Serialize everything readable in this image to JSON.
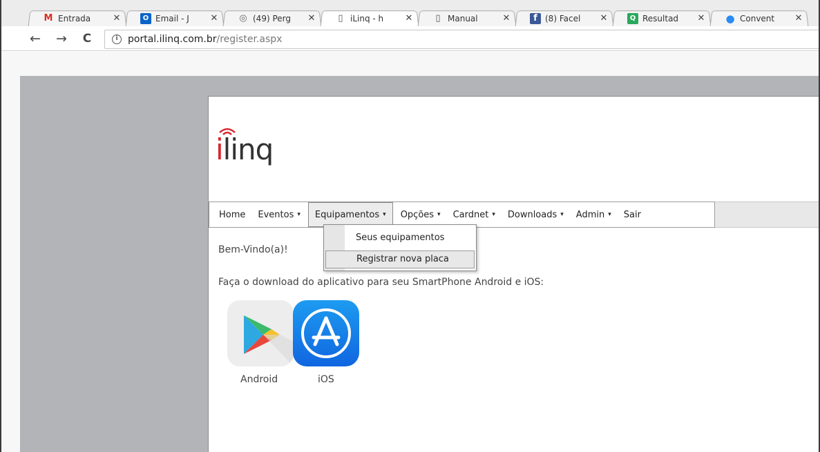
{
  "browser": {
    "tabs": [
      {
        "favicon": "gmail-icon",
        "glyph": "M",
        "color": "#d93025",
        "title": "Entrada"
      },
      {
        "favicon": "outlook-icon",
        "glyph": "O",
        "color": "#0a64c8",
        "title": "Email - J"
      },
      {
        "favicon": "quora-like-icon",
        "glyph": "◎",
        "color": "#666666",
        "title": "(49) Perg"
      },
      {
        "favicon": "page-icon",
        "glyph": "▯",
        "color": "#555555",
        "title": "iLinq - h",
        "active": true
      },
      {
        "favicon": "page-icon",
        "glyph": "▯",
        "color": "#555555",
        "title": "Manual"
      },
      {
        "favicon": "facebook-icon",
        "glyph": "f",
        "color": "#3b5998",
        "title": "(8) Facel"
      },
      {
        "favicon": "qd-icon",
        "glyph": "Q",
        "color": "#2aa85c",
        "title": "Resultad"
      },
      {
        "favicon": "chat-icon",
        "glyph": "●",
        "color": "#2a8cf0",
        "title": "Convent"
      }
    ],
    "close_glyph": "✕",
    "url_host": "portal.ilinq.com.br",
    "url_path": "/register.aspx",
    "back_glyph": "←",
    "forward_glyph": "→",
    "reload_glyph": "C",
    "info_glyph": "i"
  },
  "site": {
    "logo": {
      "i": "i",
      "rest": "linq",
      "accent": "#d7262e"
    },
    "menu": [
      {
        "label": "Home",
        "has_caret": false
      },
      {
        "label": "Eventos",
        "has_caret": true
      },
      {
        "label": "Equipamentos",
        "has_caret": true,
        "open": true
      },
      {
        "label": "Opções",
        "has_caret": true
      },
      {
        "label": "Cardnet",
        "has_caret": true
      },
      {
        "label": "Downloads",
        "has_caret": true
      },
      {
        "label": "Admin",
        "has_caret": true
      },
      {
        "label": "Sair",
        "has_caret": false
      }
    ],
    "caret_glyph": "▾",
    "dropdown": [
      {
        "label": "Seus equipamentos"
      },
      {
        "label": "Registrar nova placa",
        "hover": true
      }
    ],
    "welcome": "Bem-Vindo(a)!",
    "download_text": "Faça o download do aplicativo para seu SmartPhone Android e iOS:",
    "stores": [
      {
        "label": "Android",
        "icon": "google-play-icon"
      },
      {
        "label": "iOS",
        "icon": "app-store-icon"
      }
    ]
  }
}
